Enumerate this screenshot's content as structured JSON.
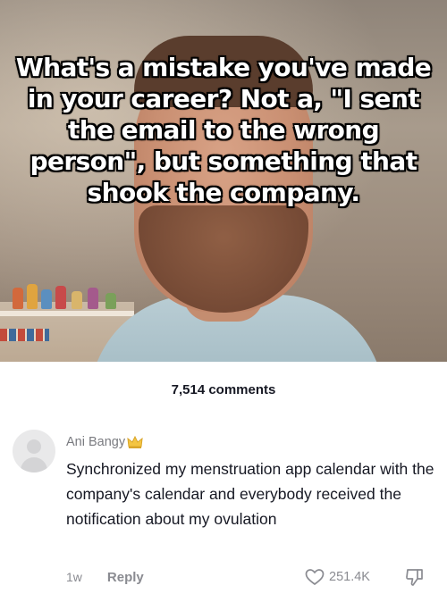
{
  "video": {
    "caption": "What's a mistake you've made in your career? Not a, \"I sent the email to the wrong person\", but something that shook the company."
  },
  "comments": {
    "count_label": "7,514 comments"
  },
  "comment": {
    "username": "Ani Bangy",
    "badge_icon": "crown-icon",
    "text": "Synchronized my menstruation app calendar with the company's calendar and everybody received the notification about my ovulation",
    "time": "1w",
    "reply_label": "Reply",
    "like_icon": "heart-icon",
    "like_count": "251.4K",
    "dislike_icon": "dislike-icon"
  },
  "colors": {
    "badge_yellow": "#f4c542",
    "meta_gray": "#8a8b91",
    "text_dark": "#161823"
  }
}
